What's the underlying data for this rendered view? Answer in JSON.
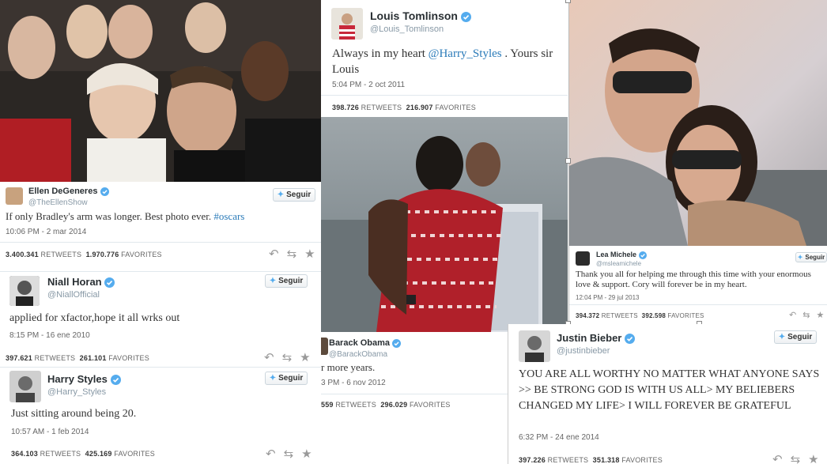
{
  "follow_label": "Seguir",
  "tweets": {
    "ellen": {
      "name": "Ellen DeGeneres",
      "handle": "@TheEllenShow",
      "text": "If only Bradley's arm was longer. Best photo ever. ",
      "hashtag": "#oscars",
      "time": "10:06 PM - 2 mar 2014",
      "retweets": "3.400.341",
      "favorites": "1.970.776"
    },
    "niall": {
      "name": "Niall Horan",
      "handle": "@NiallOfficial",
      "text": "applied for xfactor,hope it all wrks out",
      "time": "8:15 PM - 16 ene 2010",
      "retweets": "397.621",
      "favorites": "261.101"
    },
    "harry": {
      "name": "Harry Styles",
      "handle": "@Harry_Styles",
      "text": "Just sitting around being 20.",
      "time": "10:57 AM - 1 feb 2014",
      "retweets": "364.103",
      "favorites": "425.169"
    },
    "louis": {
      "name": "Louis Tomlinson",
      "handle": "@Louis_Tomlinson",
      "text_a": "Always in my heart ",
      "mention": "@Harry_Styles",
      "text_b": " . Yours sir",
      "text_c": "Louis",
      "time": "5:04 PM - 2 oct 2011",
      "retweets": "398.726",
      "favorites": "216.907"
    },
    "obama": {
      "name": "Barack Obama",
      "handle": "@BarackObama",
      "text": "r more years.",
      "time": "3 PM - 6 nov 2012",
      "retweets": "559",
      "favorites": "296.029"
    },
    "lea": {
      "name": "Lea Michele",
      "handle": "@msleamichele",
      "text": "Thank you all for helping me through this time with your enormous love & support. Cory will forever be in my heart.",
      "time": "12:04 PM - 29 jul 2013",
      "retweets": "394.372",
      "favorites": "392.598"
    },
    "bieber": {
      "name": "Justin Bieber",
      "handle": "@justinbieber",
      "text": "YOU ARE ALL WORTHY NO MATTER WHAT ANYONE SAYS >> BE STRONG GOD IS WITH US ALL> MY BELIEBERS CHANGED MY LIFE> I WILL FOREVER BE GRATEFUL",
      "time": "6:32 PM - 24 ene 2014",
      "retweets": "397.226",
      "favorites": "351.318"
    }
  },
  "labels": {
    "retweets": "RETWEETS",
    "favorites": "FAVORITES"
  }
}
